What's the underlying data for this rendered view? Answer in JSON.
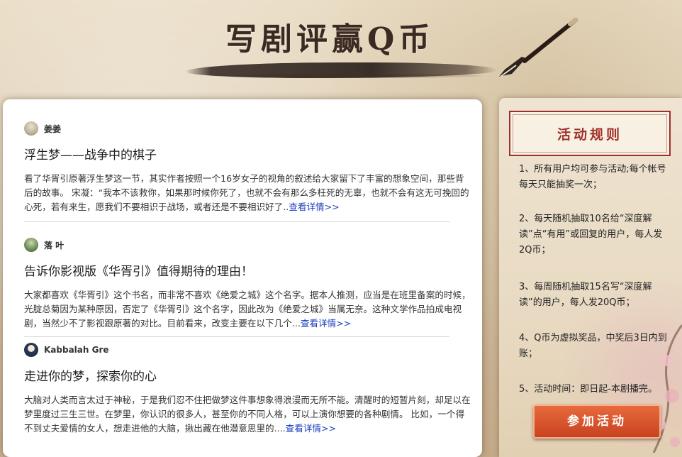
{
  "header": {
    "title": "写剧评赢Q币"
  },
  "articles": [
    {
      "author": "姜姜",
      "avatar_color": "#b9b29a",
      "title": "浮生梦——战争中的棋子",
      "excerpt": "看了华胥引原著浮生梦这一节，其实作者按照一个16岁女子的视角的叙述给大家留下了丰富的想象空间，那些背后的故事。 宋凝：“我本不该救你，如果那时候你死了，也就不会有那么多枉死的无辜，也就不会有这无可挽回的心死，若有来生，愿我们不要相识于战场，或者还是不要相识好了..",
      "more": "查看详情>>"
    },
    {
      "author": "落 叶",
      "avatar_color": "#6b8a55",
      "title": "告诉你影视版《华胥引》值得期待的理由！",
      "excerpt": "大家都喜欢《华胥引》这个书名，而非常不喜欢《绝爱之城》这个名字。据本人推测，应当是在班里备案的时候，光腚总菊因为某种原因，否定了《华胥引》这个名字，因此改为《绝爱之城》当属无奈。这种文学作品拍成电视剧，当然少不了影视跟原著的对比。目前看来，改变主要在以下几个...",
      "more": "查看详情>>"
    },
    {
      "author": "Kabbalah Gre",
      "avatar_color": "#2b3a55",
      "title": "走进你的梦，探索你的心",
      "excerpt": "大脑对人类而言太过于神秘，于是我们忍不住把做梦这件事想象得浪漫而无所不能。清醒时的短暂片刻，却足以在梦里度过三生三世。在梦里，你认识的很多人，甚至你的不同人格，可以上演你想要的各种剧情。 比如，一个得不到丈夫爱情的女人，想走进他的大脑，揪出藏在他潜意思里的....",
      "more": "查看详情>>"
    }
  ],
  "rules": {
    "heading": "活动规则",
    "items": [
      "1、所有用户均可参与活动;每个帐号每天只能抽奖一次；",
      "2、每天随机抽取10名给“深度解读”点“有用”或回复的用户，每人发2Q币；",
      "3、每周随机抽取15名写“深度解读”的用户，每人发20Q币；",
      "4、Q币为虚拟奖品，中奖后3日内到账；",
      "5、活动时间：即日起-本剧播完。"
    ],
    "join_label": "参加活动"
  }
}
